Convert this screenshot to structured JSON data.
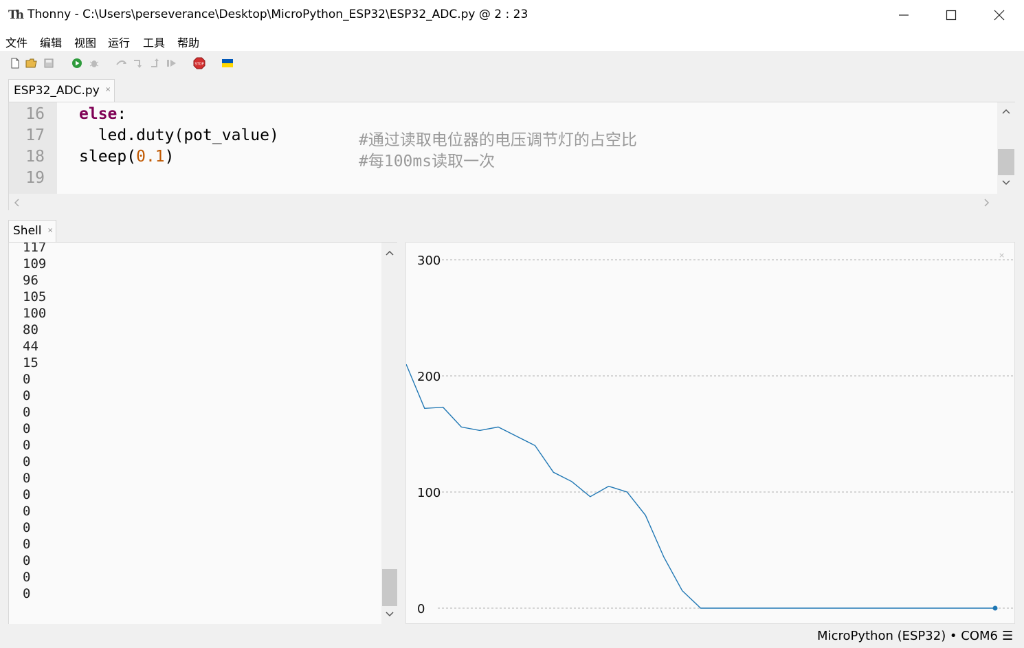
{
  "window": {
    "app_name": "Thonny",
    "title": "Thonny  -  C:\\Users\\perseverance\\Desktop\\MicroPython_ESP32\\ESP32_ADC.py  @  2 : 23",
    "minimize": "—",
    "maximize": "☐",
    "close": "✕"
  },
  "menu": [
    "文件",
    "编辑",
    "视图",
    "运行",
    "工具",
    "帮助"
  ],
  "toolbar": {
    "icons": [
      "new-file-icon",
      "open-file-icon",
      "save-icon",
      "run-icon",
      "debug-icon",
      "step-over-icon",
      "step-into-icon",
      "step-out-icon",
      "resume-icon",
      "stop-icon",
      "ukraine-flag-icon"
    ],
    "stop_label": "STOP",
    "colors": {
      "run": "#2e9b3c",
      "stop": "#d32f2f",
      "flag_blue": "#0057b7",
      "flag_yellow": "#ffd700"
    }
  },
  "editor": {
    "tab_label": "ESP32_ADC.py",
    "tab_close": "×",
    "lines": [
      {
        "no": "16",
        "indent": "",
        "code": "else",
        "code2": ":",
        "comment": ""
      },
      {
        "no": "17",
        "indent": "  ",
        "code": "led.duty(pot_value)",
        "comment": "#通过读取电位器的电压调节灯的占空比"
      },
      {
        "no": "18",
        "indent": "",
        "code": "sleep(",
        "num": "0.1",
        "code2": ")",
        "comment": "#每100ms读取一次"
      },
      {
        "no": "19",
        "indent": "",
        "code": "",
        "comment": ""
      }
    ],
    "colors": {
      "keyword": "#7f0055",
      "number": "#c05800",
      "comment": "#9a9a9a"
    }
  },
  "shell": {
    "tab_label": "Shell",
    "tab_close": "×",
    "output": [
      "117",
      "109",
      "96",
      "105",
      "100",
      "80",
      "44",
      "15",
      "0",
      "0",
      "0",
      "0",
      "0",
      "0",
      "0",
      "0",
      "0",
      "0",
      "0",
      "0",
      "0",
      "0"
    ]
  },
  "chart_data": {
    "type": "line",
    "ylim": [
      0,
      300
    ],
    "yticks": [
      "300",
      "200",
      "100",
      "0"
    ],
    "grid": true,
    "close_label": "×",
    "series": [
      {
        "color": "#1f77b4",
        "values": [
          210,
          172,
          173,
          156,
          153,
          156,
          148,
          140,
          117,
          109,
          96,
          105,
          100,
          80,
          44,
          15,
          0,
          0,
          0,
          0,
          0,
          0,
          0,
          0,
          0,
          0,
          0,
          0,
          0,
          0,
          0,
          0,
          0
        ]
      }
    ]
  },
  "status": {
    "text": "MicroPython (ESP32)  •  COM6",
    "menu_icon": "☰"
  }
}
